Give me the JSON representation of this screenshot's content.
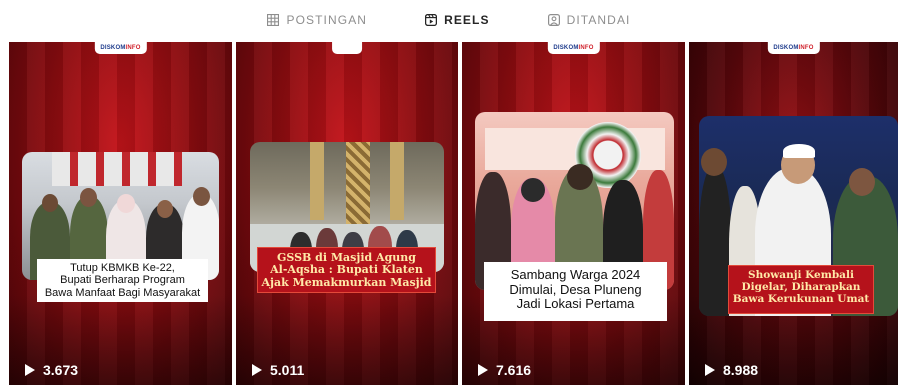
{
  "tabs": [
    {
      "label": "POSTINGAN",
      "icon": "grid-icon",
      "active": false
    },
    {
      "label": "REELS",
      "icon": "reels-icon",
      "active": true
    },
    {
      "label": "DITANDAI",
      "icon": "tagged-icon",
      "active": false
    }
  ],
  "brand": {
    "logo_main": "DISKOM",
    "logo_sub": "INFO"
  },
  "colors": {
    "accent_red": "#b5121b",
    "caption_yellow": "#ffe9a8",
    "active_tab": "#262626",
    "inactive_tab": "#8e8e8e"
  },
  "reels": [
    {
      "caption": [
        "Tutup KBMKB Ke-22,",
        "Bupati Berharap Program",
        "Bawa Manfaat Bagi Masyarakat"
      ],
      "caption_style": "white",
      "plays": "3.673"
    },
    {
      "caption": [
        "GSSB di Masjid Agung",
        "Al-Aqsha : Bupati Klaten",
        "Ajak Memakmurkan Masjid"
      ],
      "caption_style": "red",
      "plays": "5.011"
    },
    {
      "caption": [
        "Sambang Warga 2024",
        "Dimulai, Desa Pluneng",
        "Jadi Lokasi Pertama"
      ],
      "caption_style": "white",
      "plays": "7.616"
    },
    {
      "caption": [
        "Showanji Kembali",
        "Digelar, Diharapkan",
        "Bawa Kerukunan Umat"
      ],
      "caption_style": "red",
      "plays": "8.988"
    }
  ]
}
